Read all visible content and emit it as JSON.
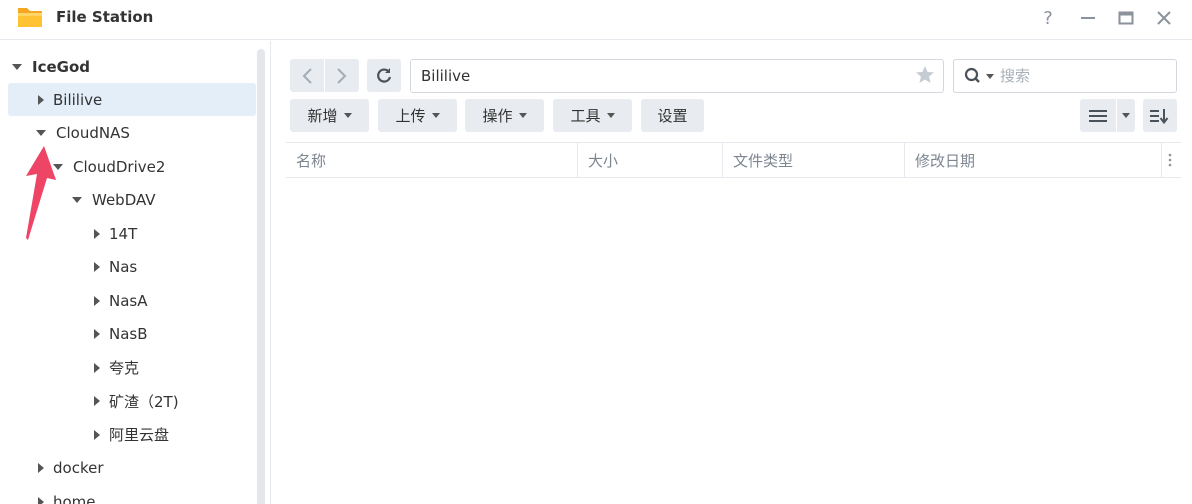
{
  "window": {
    "title": "File Station",
    "buttons": {
      "help": "?",
      "minimize": "—",
      "maximize": "□",
      "close": "✕"
    }
  },
  "sidebar": {
    "root": "IceGod",
    "items": [
      {
        "label": "Bililive",
        "level": 1,
        "expanded": false,
        "selected": true
      },
      {
        "label": "CloudNAS",
        "level": 1,
        "expanded": true
      },
      {
        "label": "CloudDrive2",
        "level": 2,
        "expanded": true
      },
      {
        "label": "WebDAV",
        "level": 3,
        "expanded": true
      },
      {
        "label": "14T",
        "level": 4,
        "expanded": false
      },
      {
        "label": "Nas",
        "level": 4,
        "expanded": false
      },
      {
        "label": "NasA",
        "level": 4,
        "expanded": false
      },
      {
        "label": "NasB",
        "level": 4,
        "expanded": false
      },
      {
        "label": "夸克",
        "level": 4,
        "expanded": false
      },
      {
        "label": "矿渣（2T)",
        "level": 4,
        "expanded": false
      },
      {
        "label": "阿里云盘",
        "level": 4,
        "expanded": false
      },
      {
        "label": "docker",
        "level": 1,
        "expanded": false
      },
      {
        "label": "home",
        "level": 1,
        "expanded": false
      }
    ]
  },
  "toolbar": {
    "path": "Bililive",
    "search_placeholder": "搜索",
    "create": "新增",
    "upload": "上传",
    "action": "操作",
    "tools": "工具",
    "settings": "设置"
  },
  "columns": [
    "名称",
    "大小",
    "文件类型",
    "修改日期"
  ],
  "colors": {
    "selected_bg": "#e4eef9",
    "button_bg": "#e8ecf0",
    "arrow": "#ee4466"
  },
  "icons": [
    "folder-icon",
    "back-icon",
    "forward-icon",
    "refresh-icon",
    "star-icon",
    "search-icon",
    "list-view-icon",
    "sort-icon"
  ]
}
